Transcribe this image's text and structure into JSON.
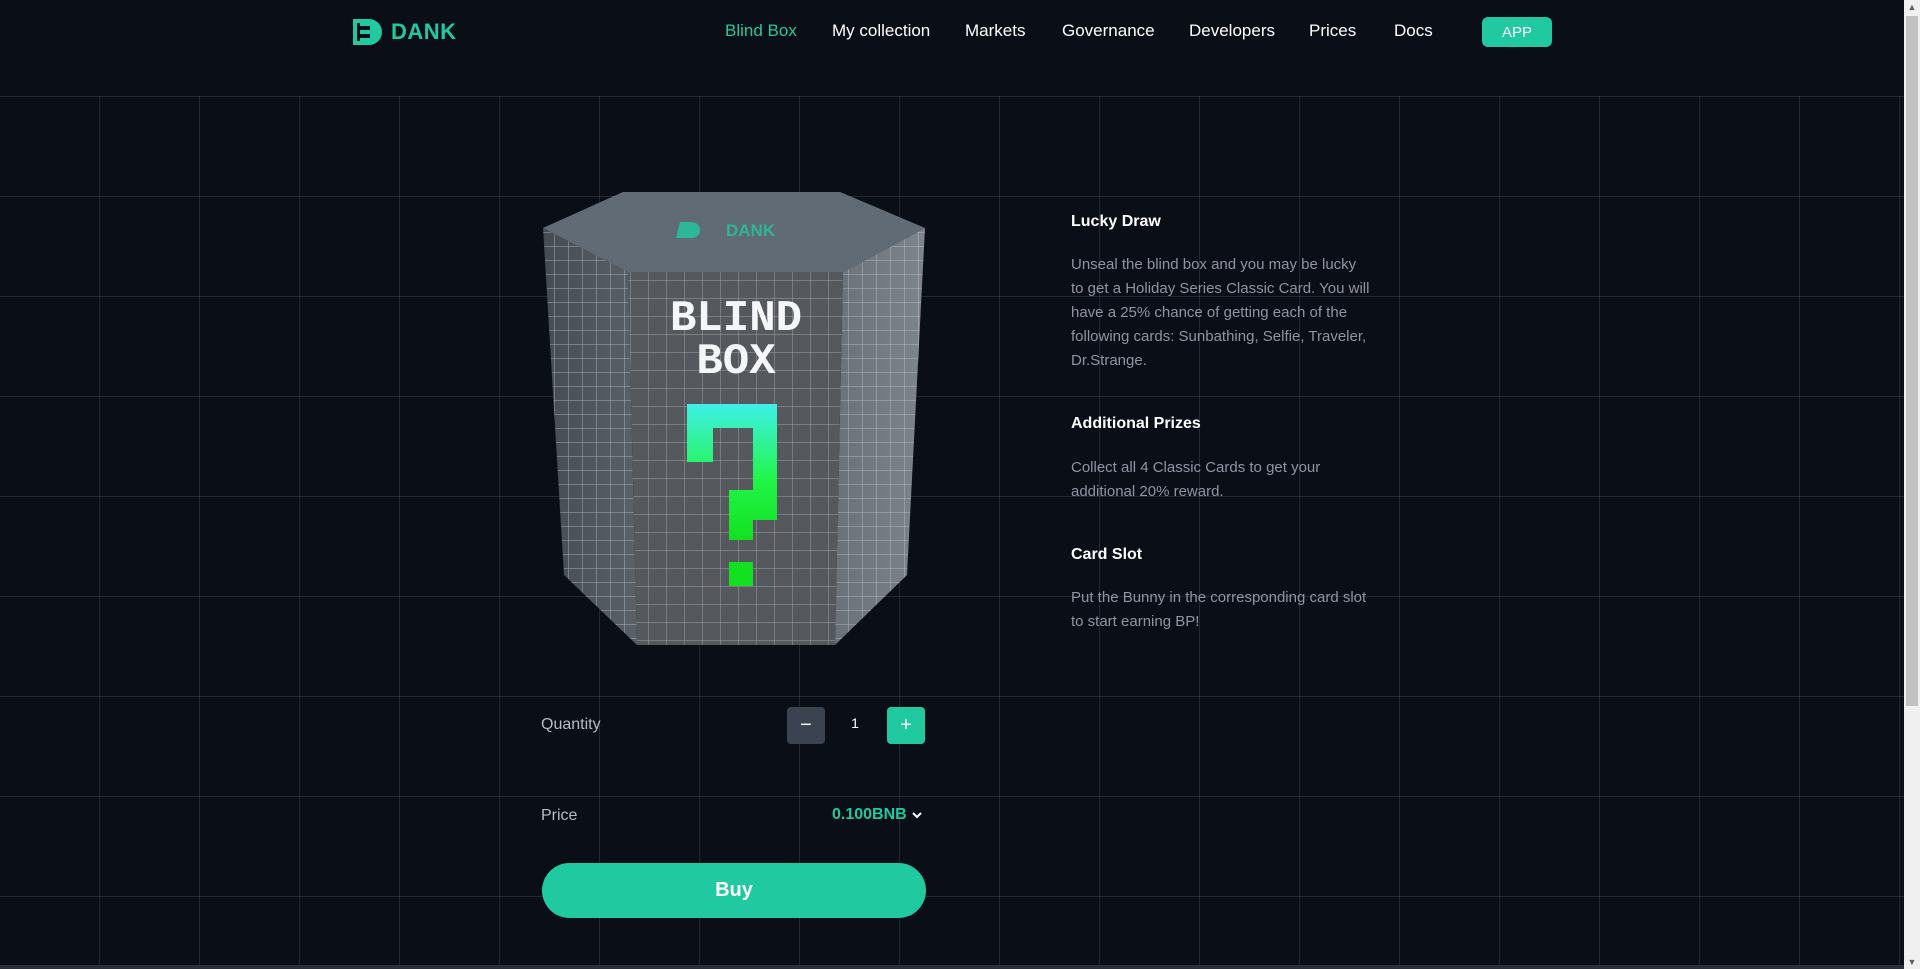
{
  "brand": {
    "name": "DANK",
    "accent": "#21c9a0"
  },
  "nav": {
    "items": [
      {
        "label": "Blind Box",
        "active": true
      },
      {
        "label": "My collection",
        "active": false
      },
      {
        "label": "Markets",
        "active": false
      },
      {
        "label": "Governance",
        "active": false
      },
      {
        "label": "Developers",
        "active": false
      },
      {
        "label": "Prices",
        "active": false
      },
      {
        "label": "Docs",
        "active": false
      }
    ],
    "app_label": "APP"
  },
  "box": {
    "line1": "BLIND",
    "line2": "BOX",
    "mark": "?",
    "top_brand": "DANK"
  },
  "info": {
    "sections": [
      {
        "title": "Lucky Draw",
        "text": "Unseal the blind box and you may be lucky to get a Holiday Series Classic Card. You will have a 25% chance of getting each of the following cards: Sunbathing, Selfie, Traveler, Dr.Strange."
      },
      {
        "title": "Additional Prizes",
        "text": "Collect all 4 Classic Cards to get your additional 20% reward."
      },
      {
        "title": "Card Slot",
        "text": "Put the Bunny in the corresponding card slot to start earning BP!"
      }
    ]
  },
  "purchase": {
    "quantity_label": "Quantity",
    "quantity": "1",
    "minus": "−",
    "plus": "+",
    "price_label": "Price",
    "price": "0.100BNB",
    "buy_label": "Buy"
  }
}
